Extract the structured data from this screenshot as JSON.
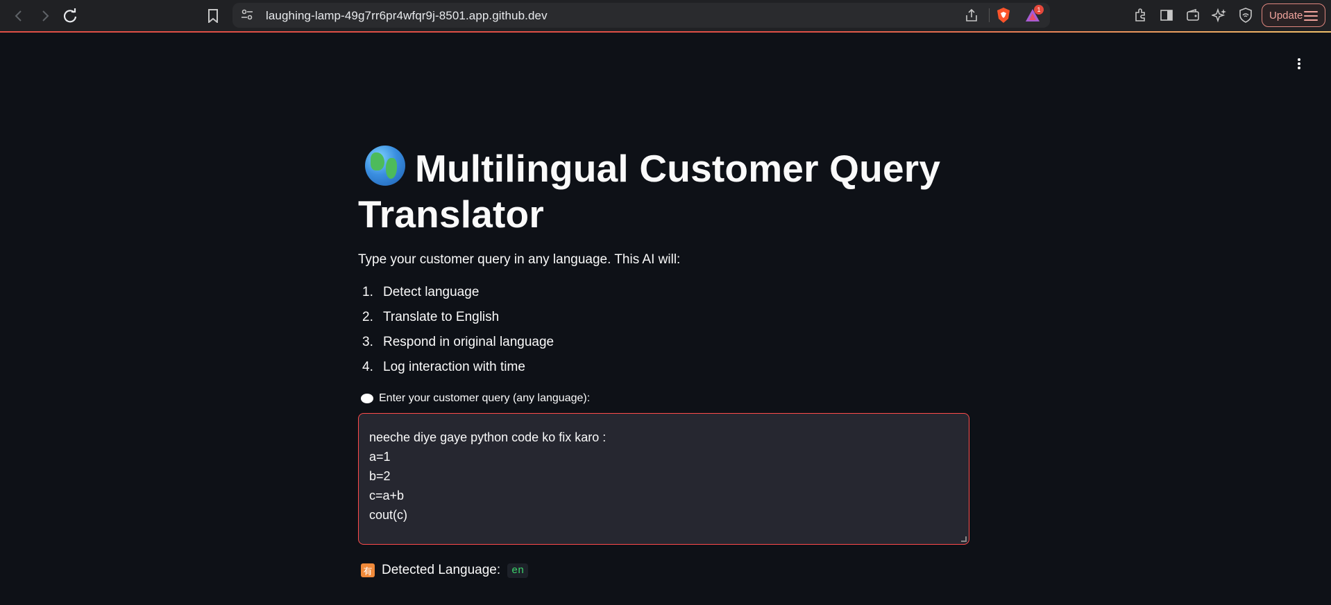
{
  "browser": {
    "url": "laughing-lamp-49g7rr6pr4wfqr9j-8501.app.github.dev",
    "update_label": "Update",
    "notification_count": "1"
  },
  "app": {
    "title": "Multilingual Customer Query Translator",
    "intro": "Type your customer query in any language. This AI will:",
    "steps": [
      {
        "num": "1.",
        "text": "Detect language"
      },
      {
        "num": "2.",
        "text": "Translate to English"
      },
      {
        "num": "3.",
        "text": "Respond in original language"
      },
      {
        "num": "4.",
        "text": "Log interaction with time"
      }
    ],
    "query_label": "Enter your customer query (any language):",
    "query_value": "neeche diye gaye python code ko fix karo :\na=1\nb=2\nc=a+b\ncout(c)",
    "detected_label": "Detected Language:",
    "detected_value": "en"
  },
  "colors": {
    "background": "#0e1117",
    "accent_border": "#ff4b4b",
    "code_green": "#3dd56d"
  }
}
